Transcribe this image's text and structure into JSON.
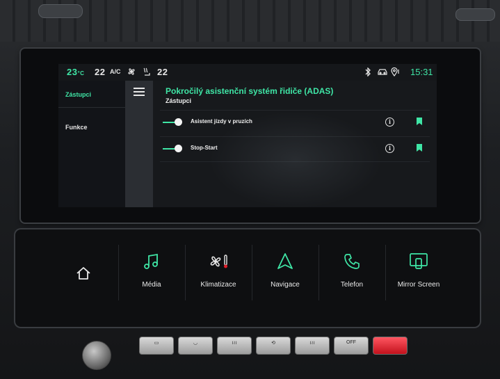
{
  "statusbar": {
    "temp_left": "23",
    "temp_left_unit": "°C",
    "fan_level": "22",
    "ac_label": "A/C",
    "temp_right": "22",
    "clock": "15:31"
  },
  "sidebar": {
    "items": [
      {
        "label": "Zástupci",
        "active": true
      },
      {
        "label": "Funkce",
        "active": false
      }
    ]
  },
  "header": {
    "title": "Pokročilý asistenční systém řidiče (ADAS)",
    "subtitle": "Zástupci"
  },
  "settings": {
    "rows": [
      {
        "label": "Asistent jízdy v pruzích",
        "enabled": true
      },
      {
        "label": "Stop-Start",
        "enabled": true
      }
    ]
  },
  "shortcuts": [
    {
      "label": "",
      "icon": "home-icon"
    },
    {
      "label": "Média",
      "icon": "music-note-icon"
    },
    {
      "label": "Klimatizace",
      "icon": "climate-fan-icon"
    },
    {
      "label": "Navigace",
      "icon": "navigation-arrow-icon"
    },
    {
      "label": "Telefon",
      "icon": "phone-icon"
    },
    {
      "label": "Mirror Screen",
      "icon": "mirror-screen-icon"
    }
  ],
  "hardware_buttons": [
    {
      "label": "",
      "icon": "rear-defrost-icon"
    },
    {
      "label": "",
      "icon": "front-defrost-icon"
    },
    {
      "label": "",
      "icon": "windshield-heat-icon"
    },
    {
      "label": "",
      "icon": "recirculation-icon"
    },
    {
      "label": "",
      "icon": "rear-window-heat-icon"
    },
    {
      "label": "OFF",
      "icon": "climate-off-icon"
    }
  ],
  "colors": {
    "accent": "#3fe6a6",
    "hazard": "#e01c28"
  }
}
